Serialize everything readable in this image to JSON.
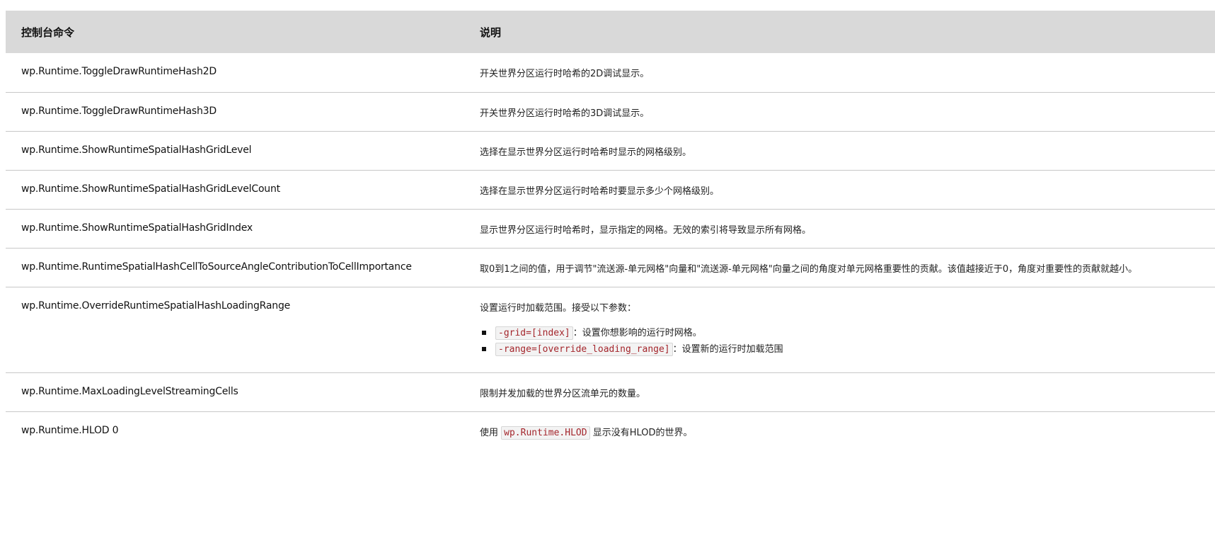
{
  "table": {
    "headers": {
      "command": "控制台命令",
      "description": "说明"
    },
    "rows": [
      {
        "command": "wp.Runtime.ToggleDrawRuntimeHash2D",
        "description": "开关世界分区运行时哈希的2D调试显示。"
      },
      {
        "command": "wp.Runtime.ToggleDrawRuntimeHash3D",
        "description": "开关世界分区运行时哈希的3D调试显示。"
      },
      {
        "command": "wp.Runtime.ShowRuntimeSpatialHashGridLevel",
        "description": "选择在显示世界分区运行时哈希时显示的网格级别。"
      },
      {
        "command": "wp.Runtime.ShowRuntimeSpatialHashGridLevelCount",
        "description": "选择在显示世界分区运行时哈希时要显示多少个网格级别。"
      },
      {
        "command": "wp.Runtime.ShowRuntimeSpatialHashGridIndex",
        "description": "显示世界分区运行时哈希时，显示指定的网格。无效的索引将导致显示所有网格。"
      },
      {
        "command": "wp.Runtime.RuntimeSpatialHashCellToSourceAngleContributionToCellImportance",
        "description": "取0到1之间的值，用于调节\"流送源-单元网格\"向量和\"流送源-单元网格\"向量之间的角度对单元网格重要性的贡献。该值越接近于0，角度对重要性的贡献就越小。"
      },
      {
        "command": "wp.Runtime.OverrideRuntimeSpatialHashLoadingRange",
        "description": "设置运行时加载范围。接受以下参数：",
        "params": [
          {
            "code": "-grid=[index]",
            "text": "：设置你想影响的运行时网格。"
          },
          {
            "code": "-range=[override_loading_range]",
            "text": "：设置新的运行时加载范围"
          }
        ]
      },
      {
        "command": "wp.Runtime.MaxLoadingLevelStreamingCells",
        "description": "限制并发加载的世界分区流单元的数量。"
      },
      {
        "command": "wp.Runtime.HLOD 0",
        "description_prefix": "使用",
        "description_code": "wp.Runtime.HLOD",
        "description_suffix": "显示没有HLOD的世界。"
      }
    ]
  },
  "colors": {
    "header_bg": "#d9d9d9",
    "code_text": "#a4262c",
    "code_bg": "#f3f3f3",
    "row_divider": "#c8c8c8"
  }
}
